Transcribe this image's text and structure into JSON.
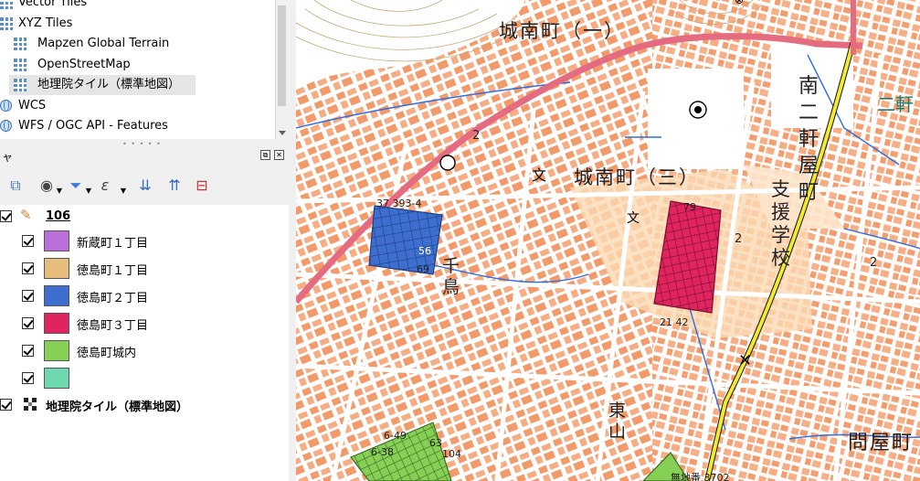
{
  "browser": {
    "items": [
      {
        "label": "Vector Tiles",
        "icon": "grid-icon"
      },
      {
        "label": "XYZ Tiles",
        "icon": "grid-icon"
      },
      {
        "label": "Mapzen Global Terrain",
        "icon": "grid-icon"
      },
      {
        "label": "OpenStreetMap",
        "icon": "grid-icon"
      },
      {
        "label": "地理院タイル（標準地図）",
        "icon": "grid-icon"
      },
      {
        "label": "WCS",
        "icon": "globe-icon"
      },
      {
        "label": "WFS / OGC API - Features",
        "icon": "globe-icon"
      }
    ]
  },
  "layers_panel": {
    "title": "ャ",
    "group": {
      "label": "106",
      "checked": true
    },
    "items": [
      {
        "label": "新蔵町１丁目",
        "color": "#b96ed8",
        "checked": true
      },
      {
        "label": "徳島町１丁目",
        "color": "#e6bd7d",
        "checked": true
      },
      {
        "label": "徳島町２丁目",
        "color": "#3e6fcf",
        "checked": true
      },
      {
        "label": "徳島町３丁目",
        "color": "#e0245f",
        "checked": true
      },
      {
        "label": "徳島町城内",
        "color": "#85d055",
        "checked": true
      },
      {
        "label": "",
        "color": "#6ed8b0",
        "checked": true
      }
    ],
    "basemap": {
      "label": "地理院タイル（標準地図）",
      "checked": true
    }
  },
  "toolbar": {
    "icons": [
      "add-group-icon",
      "visibility-icon",
      "filter-icon",
      "expression-filter-icon",
      "expand-all-icon",
      "collapse-all-icon",
      "remove-layer-icon"
    ]
  },
  "map": {
    "labels": {
      "jonan1": "城南町（一）",
      "jonan3": "城南町（三）",
      "minami": "南二軒屋町",
      "shien": "支援学校",
      "senshuku": "千鳥",
      "higashi": "東山",
      "toiya": "問屋町",
      "nikken": "二軒",
      "num2a": "2",
      "num2b": "2",
      "num2c": "2",
      "blue_nums1": "37 393-4",
      "blue_nums2": "56",
      "blue_nums3": "69",
      "red_nums1": "79",
      "red_nums2": "21 42",
      "green_nums1": "6-49",
      "green_nums2": "6-38",
      "green_nums3": "63",
      "green_nums4": "104",
      "bottom_num": "無地番 3702"
    }
  }
}
